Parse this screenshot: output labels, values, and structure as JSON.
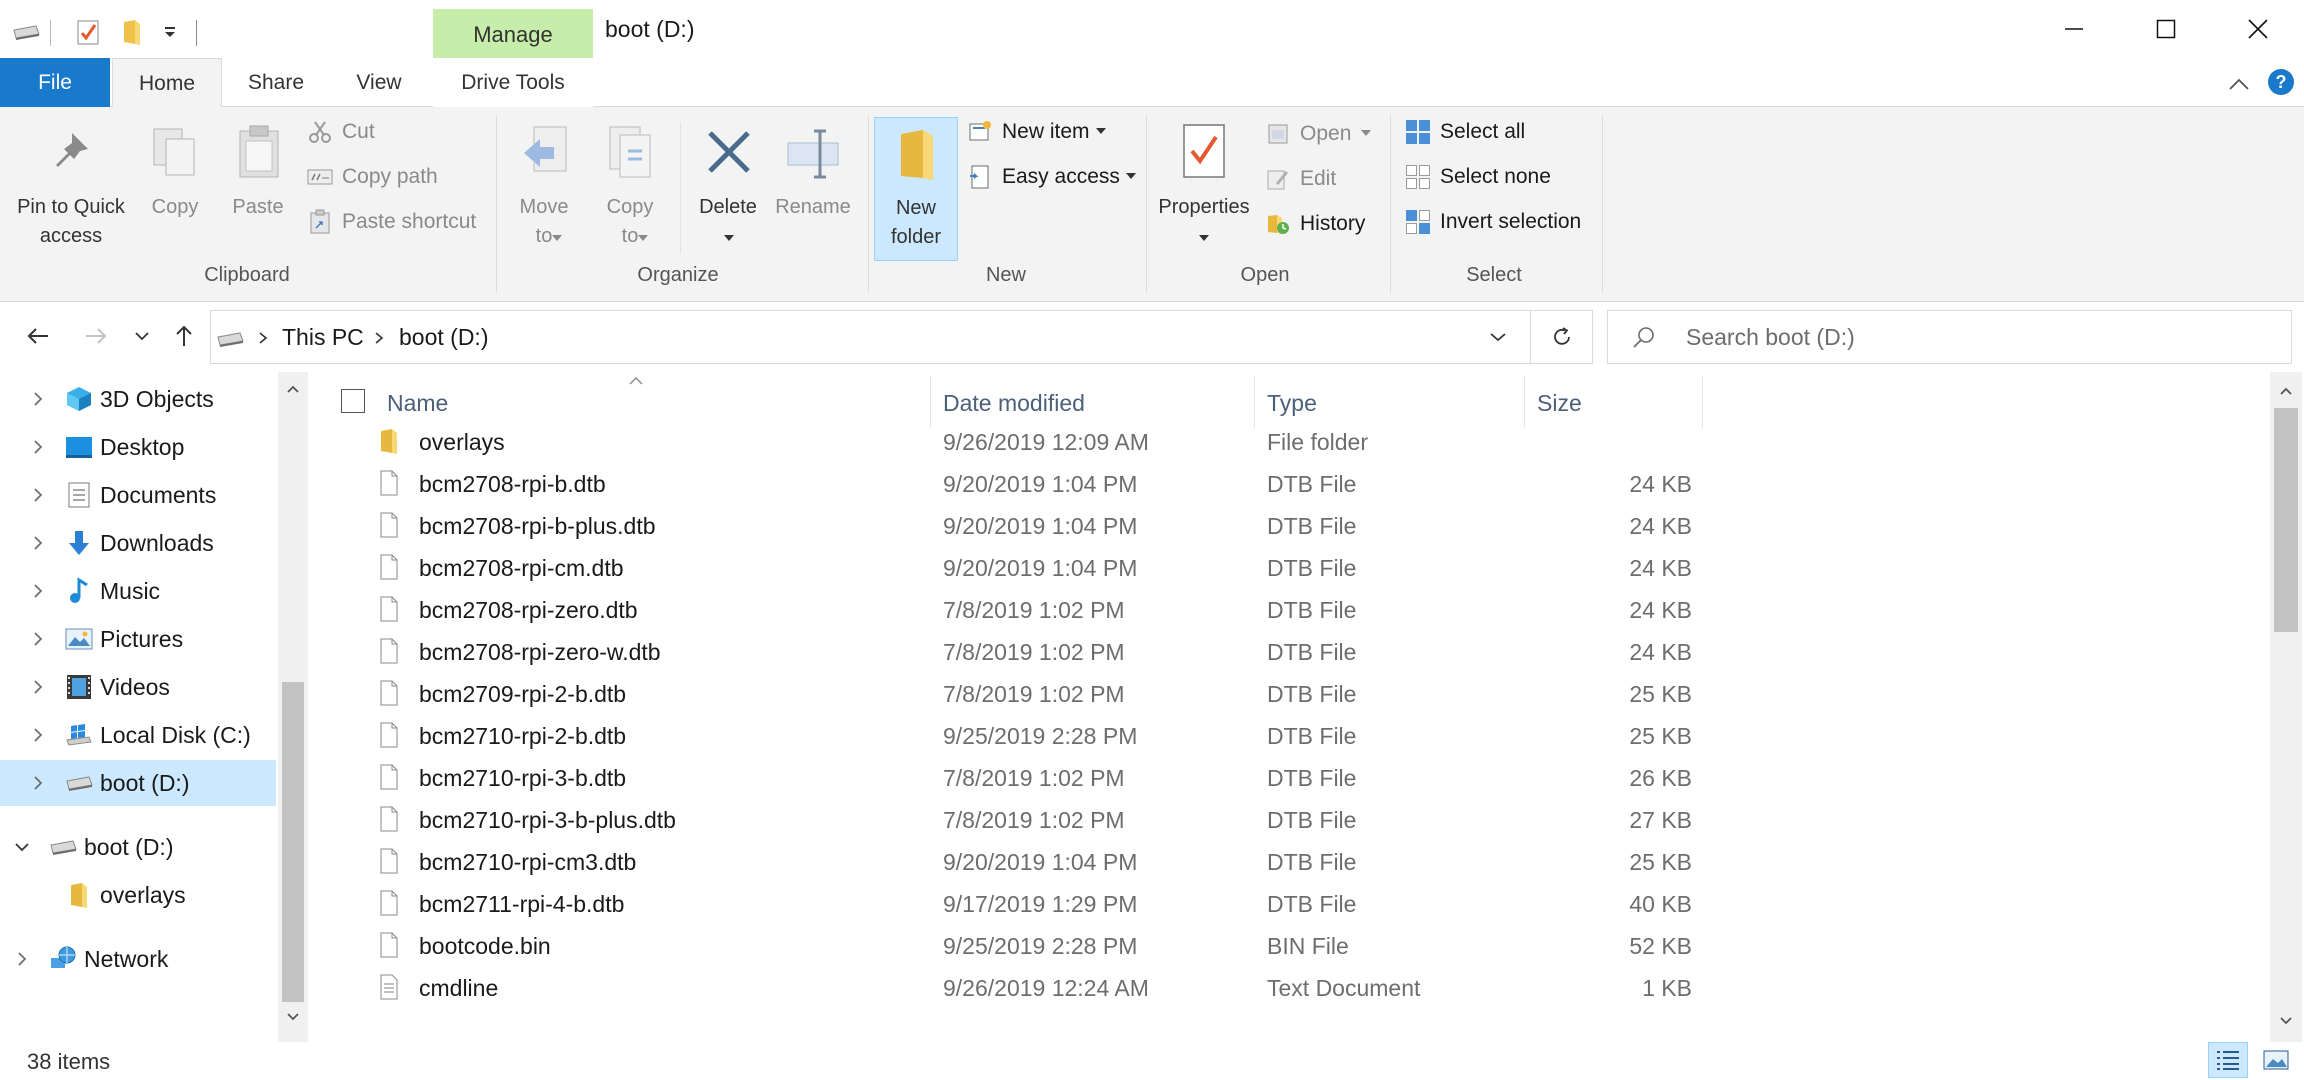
{
  "window": {
    "title": "boot (D:)",
    "context_tab": "Manage"
  },
  "tabs": {
    "file": "File",
    "home": "Home",
    "share": "Share",
    "view": "View",
    "drive_tools": "Drive Tools"
  },
  "ribbon": {
    "clipboard": {
      "pin_line1": "Pin to Quick",
      "pin_line2": "access",
      "copy": "Copy",
      "paste": "Paste",
      "cut": "Cut",
      "copy_path": "Copy path",
      "paste_shortcut": "Paste shortcut",
      "group": "Clipboard"
    },
    "organize": {
      "move_line1": "Move",
      "move_line2": "to",
      "copy_line1": "Copy",
      "copy_line2": "to",
      "delete": "Delete",
      "rename": "Rename",
      "group": "Organize"
    },
    "new": {
      "new_folder_line1": "New",
      "new_folder_line2": "folder",
      "new_item": "New item",
      "easy_access": "Easy access",
      "group": "New"
    },
    "open": {
      "properties": "Properties",
      "open": "Open",
      "edit": "Edit",
      "history": "History",
      "group": "Open"
    },
    "select": {
      "select_all": "Select all",
      "select_none": "Select none",
      "invert_selection": "Invert selection",
      "group": "Select"
    }
  },
  "address": {
    "crumbs": [
      "This PC",
      "boot (D:)"
    ],
    "search_placeholder": "Search boot (D:)"
  },
  "nav": {
    "items": [
      {
        "label": "3D Objects"
      },
      {
        "label": "Desktop"
      },
      {
        "label": "Documents"
      },
      {
        "label": "Downloads"
      },
      {
        "label": "Music"
      },
      {
        "label": "Pictures"
      },
      {
        "label": "Videos"
      },
      {
        "label": "Local Disk (C:)"
      },
      {
        "label": "boot (D:)"
      },
      {
        "label": "boot (D:)"
      },
      {
        "label": "overlays"
      },
      {
        "label": "Network"
      }
    ]
  },
  "list": {
    "columns": {
      "name": "Name",
      "date": "Date modified",
      "type": "Type",
      "size": "Size"
    },
    "rows": [
      {
        "name": "overlays",
        "date": "9/26/2019 12:09 AM",
        "type": "File folder",
        "size": ""
      },
      {
        "name": "bcm2708-rpi-b.dtb",
        "date": "9/20/2019 1:04 PM",
        "type": "DTB File",
        "size": "24 KB"
      },
      {
        "name": "bcm2708-rpi-b-plus.dtb",
        "date": "9/20/2019 1:04 PM",
        "type": "DTB File",
        "size": "24 KB"
      },
      {
        "name": "bcm2708-rpi-cm.dtb",
        "date": "9/20/2019 1:04 PM",
        "type": "DTB File",
        "size": "24 KB"
      },
      {
        "name": "bcm2708-rpi-zero.dtb",
        "date": "7/8/2019 1:02 PM",
        "type": "DTB File",
        "size": "24 KB"
      },
      {
        "name": "bcm2708-rpi-zero-w.dtb",
        "date": "7/8/2019 1:02 PM",
        "type": "DTB File",
        "size": "24 KB"
      },
      {
        "name": "bcm2709-rpi-2-b.dtb",
        "date": "7/8/2019 1:02 PM",
        "type": "DTB File",
        "size": "25 KB"
      },
      {
        "name": "bcm2710-rpi-2-b.dtb",
        "date": "9/25/2019 2:28 PM",
        "type": "DTB File",
        "size": "25 KB"
      },
      {
        "name": "bcm2710-rpi-3-b.dtb",
        "date": "7/8/2019 1:02 PM",
        "type": "DTB File",
        "size": "26 KB"
      },
      {
        "name": "bcm2710-rpi-3-b-plus.dtb",
        "date": "7/8/2019 1:02 PM",
        "type": "DTB File",
        "size": "27 KB"
      },
      {
        "name": "bcm2710-rpi-cm3.dtb",
        "date": "9/20/2019 1:04 PM",
        "type": "DTB File",
        "size": "25 KB"
      },
      {
        "name": "bcm2711-rpi-4-b.dtb",
        "date": "9/17/2019 1:29 PM",
        "type": "DTB File",
        "size": "40 KB"
      },
      {
        "name": "bootcode.bin",
        "date": "9/25/2019 2:28 PM",
        "type": "BIN File",
        "size": "52 KB"
      },
      {
        "name": "cmdline",
        "date": "9/26/2019 12:24 AM",
        "type": "Text Document",
        "size": "1 KB"
      }
    ]
  },
  "status": {
    "item_count": "38 items"
  },
  "colors": {
    "file_tab": "#1979ca",
    "context_tab": "#c6eeaa",
    "selection": "#cce8ff",
    "folder": "#f8d775",
    "help": "#1979ca"
  }
}
